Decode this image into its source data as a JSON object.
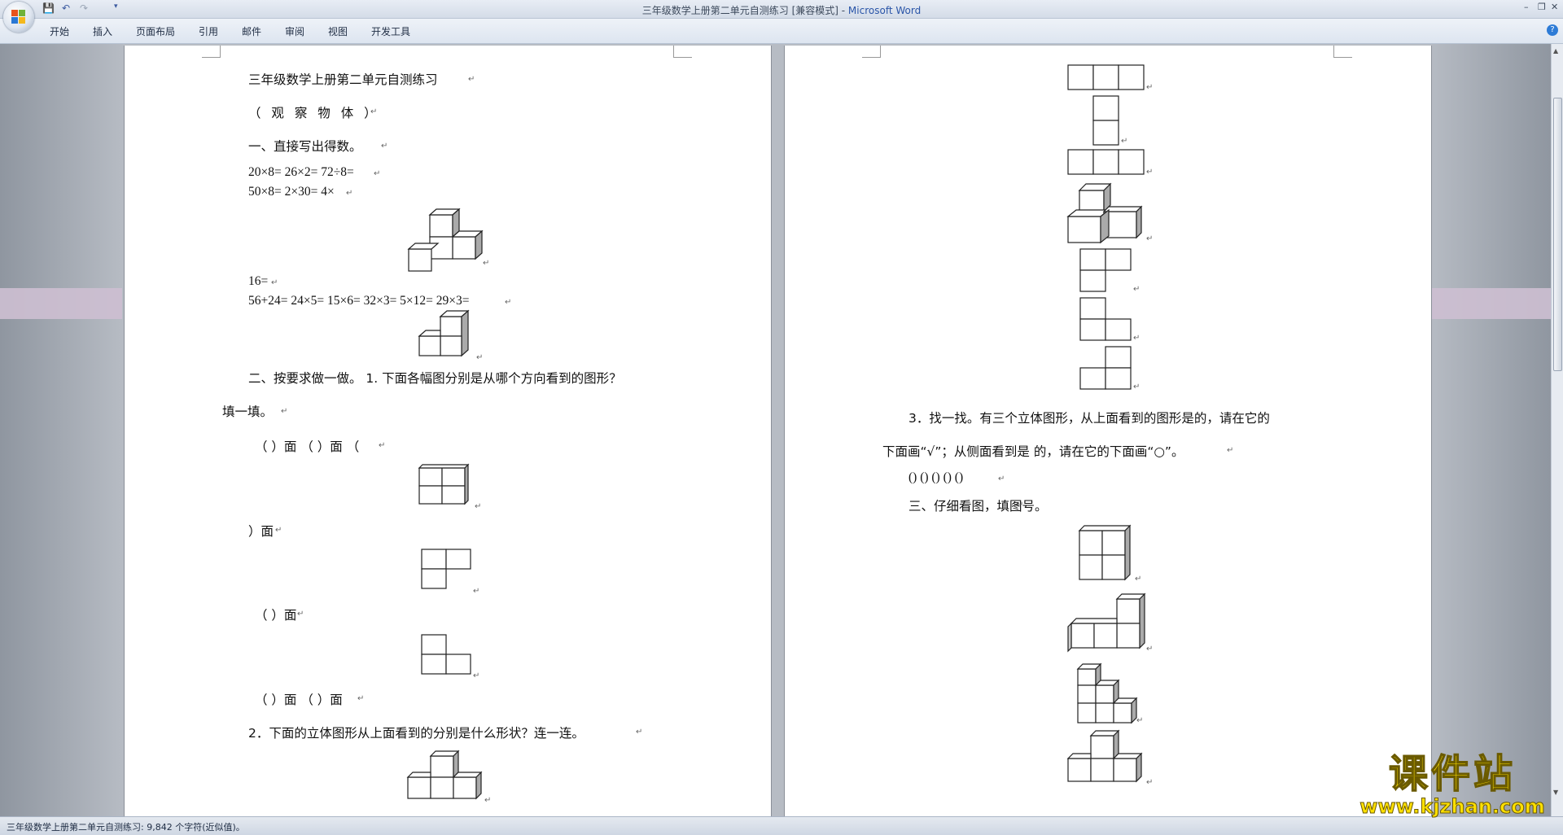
{
  "window": {
    "title": "三年级数学上册第二单元自测练习 [兼容模式] - ",
    "app_name": "Microsoft Word",
    "quick_access": [
      "save",
      "undo",
      "redo"
    ],
    "controls": [
      "minimize",
      "restore",
      "close"
    ]
  },
  "ribbon": {
    "tabs": [
      "开始",
      "插入",
      "页面布局",
      "引用",
      "邮件",
      "审阅",
      "视图",
      "开发工具"
    ]
  },
  "page1": {
    "title": "三年级数学上册第二单元自测练习",
    "subtitle": "（ 观 察 物 体 ）",
    "section1": "一、直接写出得数。",
    "calc1": "20×8= 26×2= 72÷8=",
    "calc2": "50×8= 2×30= 4×",
    "calc3": "16=",
    "calc4": "56+24= 24×5= 15×6= 32×3= 5×12= 29×3=",
    "section2": "二、按要求做一做。 1. 下面各幅图分别是从哪个方向看到的图形？",
    "fill": "填一填。",
    "blank1": "（ ）面 （ ）面 （",
    "blank2": "）面",
    "blank3": "（ ）面",
    "blank4": "（ ）面 （ ）面",
    "q2": "2．下面的立体图形从上面看到的分别是什么形状？连一连。"
  },
  "page2": {
    "q3_line1": "3．找一找。有三个立体图形，从上面看到的图形是的，请在它的",
    "q3_line2": "下面画“√”；从侧面看到是 的，请在它的下面画“○”。",
    "q3_blanks": "() () () () ()",
    "section3": "三、仔细看图，填图号。"
  },
  "paragraph_mark": "↵",
  "status": {
    "text": "三年级数学上册第二单元自测练习: 9,842 个字符(近似值)。"
  },
  "watermark": {
    "title": "课件站",
    "url": "www.kjzhan.com"
  },
  "colors": {
    "app_name": "#2a55a8",
    "watermark": "#ffe000"
  }
}
